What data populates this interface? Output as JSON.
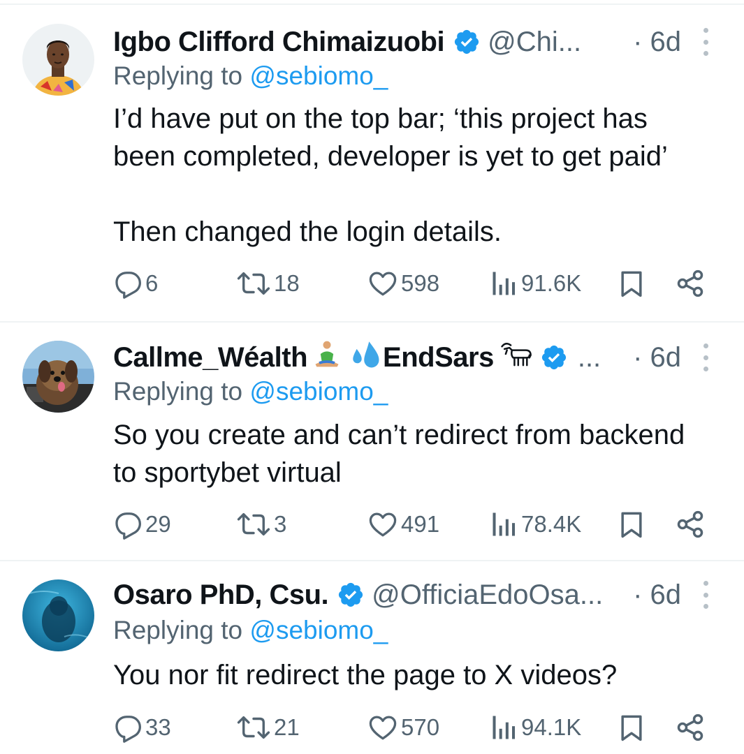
{
  "tweets": [
    {
      "name": "Igbo Clifford Chimaizuobi",
      "name_emoji": "",
      "handle": "@Chi...",
      "time": "· 6d",
      "replying_prefix": "Replying to ",
      "replying_to": "@sebiomo_",
      "text": "I’d have put on the top bar; ‘this project has been completed, developer is yet to get paid’\n\nThen changed the login details.",
      "replies": "6",
      "retweets": "18",
      "likes": "598",
      "views": "91.6K"
    },
    {
      "name": "Callme_Wéalth",
      "name_emoji": "EndSars",
      "handle": "...",
      "time": "· 6d",
      "replying_prefix": "Replying to ",
      "replying_to": "@sebiomo_",
      "text": "So you create and can’t redirect from backend to sportybet virtual",
      "replies": "29",
      "retweets": "3",
      "likes": "491",
      "views": "78.4K"
    },
    {
      "name": "Osaro PhD, Csu.",
      "name_emoji": "",
      "handle": "@OfficiaEdoOsa...",
      "time": "· 6d",
      "replying_prefix": "Replying to ",
      "replying_to": "@sebiomo_",
      "text": "You nor fit redirect the page to X videos?",
      "replies": "33",
      "retweets": "21",
      "likes": "570",
      "views": "94.1K"
    }
  ],
  "colors": {
    "verified": "#1d9bf0",
    "mention": "#1d9bf0",
    "secondary_text": "#536471",
    "primary_text": "#0f1419",
    "divider": "#eff3f4"
  },
  "icons": [
    "reply-icon",
    "retweet-icon",
    "like-icon",
    "views-icon",
    "bookmark-icon",
    "share-icon",
    "verified-badge-icon",
    "more-options-icon"
  ]
}
